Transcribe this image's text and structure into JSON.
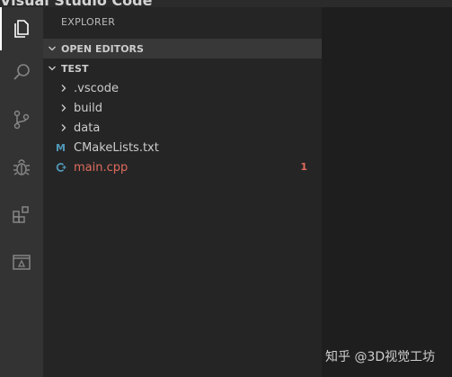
{
  "window": {
    "title": "Visual Studio Code"
  },
  "activity_bar": {
    "items": [
      {
        "icon": "files-icon",
        "active": true
      },
      {
        "icon": "search-icon"
      },
      {
        "icon": "source-control-icon"
      },
      {
        "icon": "debug-icon"
      },
      {
        "icon": "extensions-icon"
      },
      {
        "icon": "remote-explorer-icon"
      }
    ]
  },
  "sidebar": {
    "title": "EXPLORER",
    "open_editors_label": "OPEN EDITORS",
    "project_label": "TEST",
    "tree": [
      {
        "label": ".vscode",
        "type": "folder"
      },
      {
        "label": "build",
        "type": "folder"
      },
      {
        "label": "data",
        "type": "folder"
      },
      {
        "label": "CMakeLists.txt",
        "type": "file",
        "icon_glyph": "M",
        "color": "#519aba"
      },
      {
        "label": "main.cpp",
        "type": "file",
        "icon_glyph": "G",
        "color": "#e06c5c",
        "badge": "1",
        "label_color": "#e06c5c"
      }
    ]
  },
  "watermark": {
    "text": "知乎 @3D视觉工坊"
  }
}
